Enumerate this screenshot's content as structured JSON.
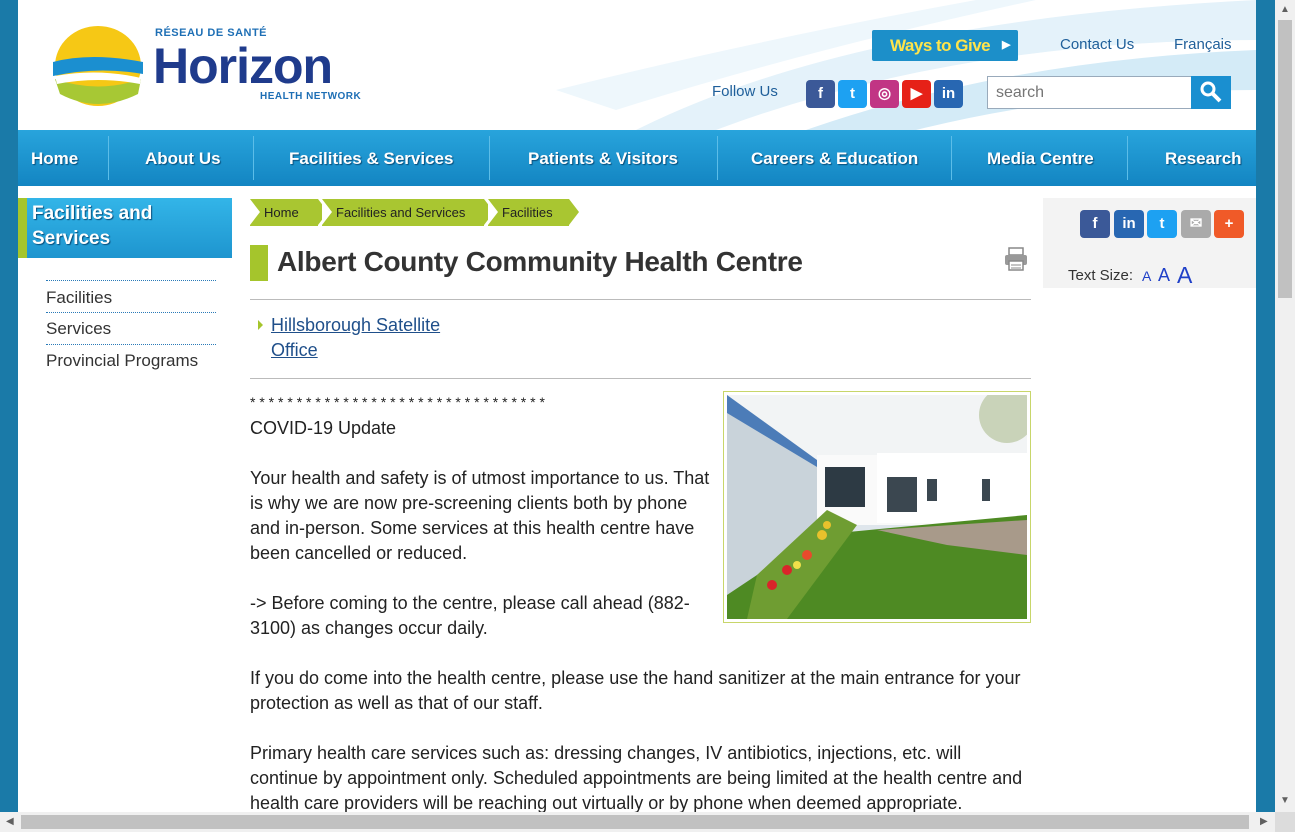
{
  "header": {
    "logo": {
      "small": "RÉSEAU DE SANTÉ",
      "big": "Horizon",
      "sub": "HEALTH NETWORK"
    },
    "ways_to_give": "Ways to Give",
    "contact_us": "Contact Us",
    "francais": "Français",
    "follow_us": "Follow Us",
    "search_placeholder": "search"
  },
  "social_icons": [
    {
      "name": "facebook-icon",
      "glyph": "f",
      "color": "#3b5998"
    },
    {
      "name": "twitter-icon",
      "glyph": "t",
      "color": "#1da1f2"
    },
    {
      "name": "instagram-icon",
      "glyph": "◎",
      "color": "#c13584"
    },
    {
      "name": "youtube-icon",
      "glyph": "▶",
      "color": "#e62117"
    },
    {
      "name": "linkedin-icon",
      "glyph": "in",
      "color": "#2867b2"
    }
  ],
  "nav": [
    "Home",
    "About Us",
    "Facilities & Services",
    "Patients & Visitors",
    "Careers & Education",
    "Media Centre",
    "Research"
  ],
  "sidebar": {
    "heading": "Facilities and Services",
    "items": [
      "Facilities",
      "Services",
      "Provincial Programs"
    ]
  },
  "breadcrumb": [
    "Home",
    "Facilities and Services",
    "Facilities"
  ],
  "main": {
    "title": "Albert County Community Health Centre",
    "satellite_link": "Hillsborough Satellite Office",
    "stars": "* * * * * * * * * * * * * * * * * * * * * * * * * * * * * * * *",
    "covid_heading": "COVID-19 Update",
    "para1": "Your health and safety is of utmost importance to us. That is why we are now pre-screening clients both by phone and in-person. Some services at this health centre have been cancelled or reduced.",
    "para2": "-> Before coming to the centre, please call ahead (882-3100) as changes occur daily.",
    "para3": "If you do come into the health centre, please use the hand sanitizer at the main entrance for your protection as well as that of our staff.",
    "para4": "Primary health care services such as: dressing changes, IV antibiotics, injections, etc. will continue by appointment only. Scheduled appointments are being limited at the health centre and health care providers will be reaching out virtually or by phone when deemed appropriate."
  },
  "share": {
    "icons": [
      {
        "name": "facebook-share-icon",
        "glyph": "f",
        "color": "#3b5998"
      },
      {
        "name": "linkedin-share-icon",
        "glyph": "in",
        "color": "#2867b2"
      },
      {
        "name": "twitter-share-icon",
        "glyph": "t",
        "color": "#1da1f2"
      },
      {
        "name": "email-share-icon",
        "glyph": "✉",
        "color": "#aaaaaa"
      },
      {
        "name": "more-share-icon",
        "glyph": "+",
        "color": "#f05a28"
      }
    ],
    "text_size_label": "Text Size:",
    "sizes": [
      "A",
      "A",
      "A"
    ]
  }
}
